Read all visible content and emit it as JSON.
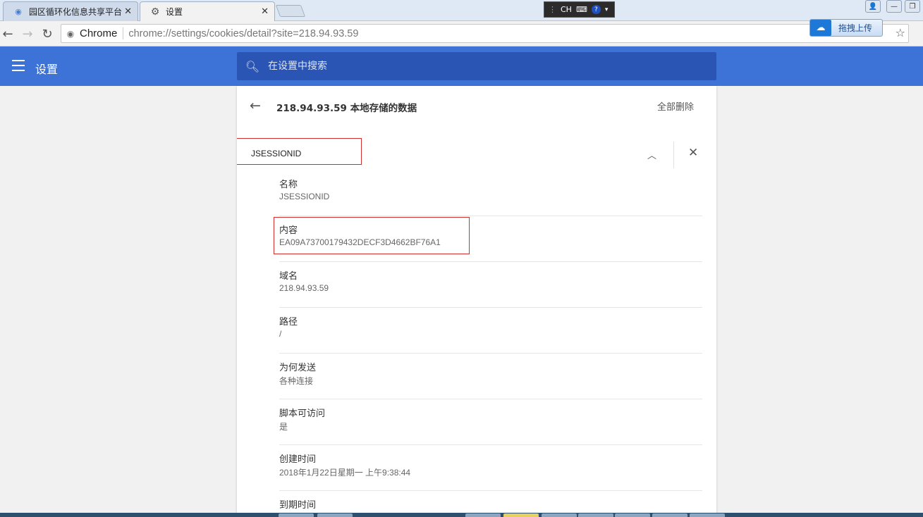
{
  "browser": {
    "tabs": [
      {
        "title": "园区循环化信息共享平台",
        "icon": "globe-icon",
        "active": false
      },
      {
        "title": "设置",
        "icon": "gear-icon",
        "active": true
      }
    ],
    "ime_label": "CH",
    "omnibox": {
      "site_chip": "Chrome",
      "url": "chrome://settings/cookies/detail?site=218.94.93.59"
    },
    "upload_label": "拖拽上传"
  },
  "settings": {
    "title": "设置",
    "search_placeholder": "在设置中搜索"
  },
  "detail": {
    "title": "218.94.93.59 本地存储的数据",
    "remove_all": "全部删除",
    "cookie_name": "JSESSIONID",
    "fields": [
      {
        "label": "名称",
        "value": "JSESSIONID"
      },
      {
        "label": "内容",
        "value": "EA09A73700179432DECF3D4662BF76A1"
      },
      {
        "label": "域名",
        "value": "218.94.93.59"
      },
      {
        "label": "路径",
        "value": "/"
      },
      {
        "label": "为何发送",
        "value": "各种连接"
      },
      {
        "label": "脚本可访问",
        "value": "是"
      },
      {
        "label": "创建时间",
        "value": "2018年1月22日星期一 上午9:38:44"
      },
      {
        "label": "到期时间",
        "value": ""
      }
    ]
  },
  "colors": {
    "header_blue": "#3d72d7",
    "search_blue": "#2a55b5",
    "highlight_red": "#d32f2f"
  }
}
